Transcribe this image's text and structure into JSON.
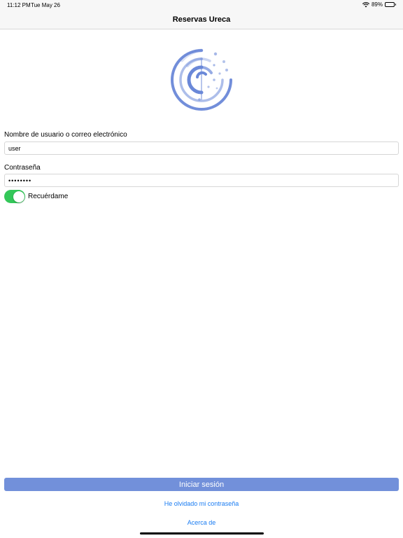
{
  "status_bar": {
    "time": "11:12 PM",
    "date": "Tue May 26",
    "battery_percent": "89%",
    "battery_level": 0.89
  },
  "nav": {
    "title": "Reservas Ureca"
  },
  "logo": {
    "icon": "ureca-logo-icon",
    "color": "#6a88d8"
  },
  "form": {
    "username_label": "Nombre de usuario o correo electrónico",
    "username_value": "user",
    "password_label": "Contraseña",
    "password_value": "••••••••",
    "remember_label": "Recuérdame",
    "remember_on": true
  },
  "actions": {
    "login_label": "Iniciar sesión",
    "forgot_label": "He olvidado mi contraseña",
    "about_label": "Acerca de"
  },
  "colors": {
    "accent": "#7290da",
    "link": "#1a7cf2",
    "toggle_on": "#34c759"
  }
}
